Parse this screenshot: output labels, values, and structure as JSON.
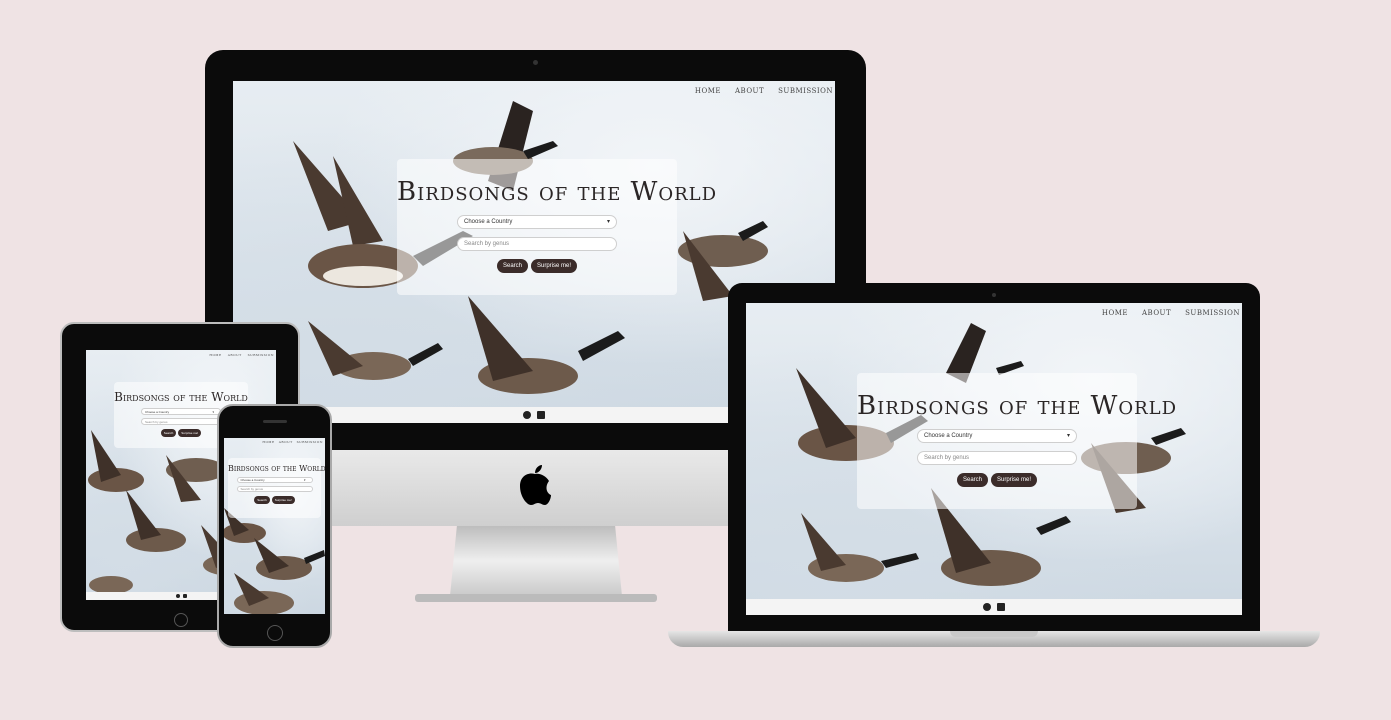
{
  "site": {
    "title": "Birdsongs of the World",
    "nav": [
      "Home",
      "About",
      "Submission"
    ],
    "country_select": "Choose a Country",
    "genus_placeholder": "Search by genus",
    "search_button": "Search",
    "surprise_button": "Surprise me!",
    "footer_icons": [
      "github-icon",
      "linkedin-icon"
    ]
  },
  "devices": [
    "desktop-monitor",
    "laptop",
    "tablet",
    "phone"
  ],
  "colors": {
    "background": "#efe3e4",
    "button": "#3b2c2a",
    "device_frame": "#0b0b0b",
    "sky": "#dde5ec"
  }
}
